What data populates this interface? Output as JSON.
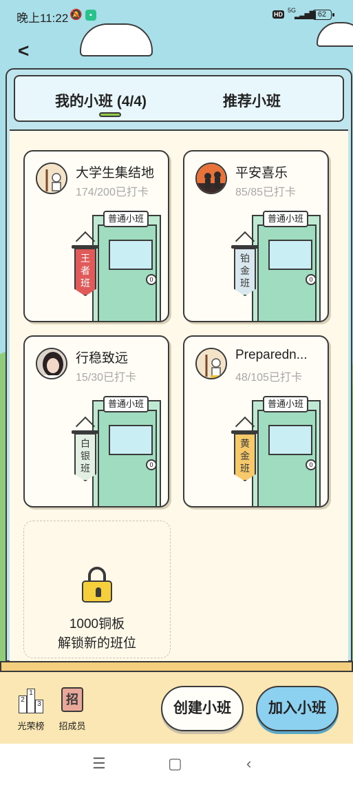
{
  "status_bar": {
    "time": "晚上11:22",
    "hd": "HD",
    "network": "5G",
    "battery": "62"
  },
  "tabs": [
    {
      "label": "我的小班 (4/4)",
      "active": true
    },
    {
      "label": "推荐小班",
      "active": false
    }
  ],
  "classes": [
    {
      "name": "大学生集结地",
      "count": "174/200已打卡",
      "door_sign": "普通小班",
      "rank": "王者班",
      "rank_chars": [
        "王",
        "者",
        "班"
      ],
      "rank_color": "#e05a5a",
      "rank_text_color": "#ffffff"
    },
    {
      "name": "平安喜乐",
      "count": "85/85已打卡",
      "door_sign": "普通小班",
      "rank": "铂金班",
      "rank_chars": [
        "铂",
        "金",
        "班"
      ],
      "rank_color": "#d9e8ef",
      "rank_text_color": "#3a3a3a"
    },
    {
      "name": "行稳致远",
      "count": "15/30已打卡",
      "door_sign": "普通小班",
      "rank": "白银班",
      "rank_chars": [
        "白",
        "银",
        "班"
      ],
      "rank_color": "#e3efe3",
      "rank_text_color": "#3a3a3a"
    },
    {
      "name": "Preparedn...",
      "count": "48/105已打卡",
      "door_sign": "普通小班",
      "rank": "黄金班",
      "rank_chars": [
        "黄",
        "金",
        "班"
      ],
      "rank_color": "#f6c96a",
      "rank_text_color": "#3a3a3a"
    }
  ],
  "door_knob_label": "0",
  "locked_slot": {
    "line1": "1000铜板",
    "line2": "解锁新的班位"
  },
  "bottom": {
    "honor_label": "光荣榜",
    "honor_podium": [
      "2",
      "1",
      "3"
    ],
    "recruit_label": "招成员",
    "recruit_glyph": "招",
    "create_button": "创建小班",
    "join_button": "加入小班"
  },
  "colors": {
    "sky": "#a9dfe8",
    "grass": "#8fcd7b",
    "join_button": "#8dd1f1",
    "tab_underline": "#8fcd4a"
  }
}
